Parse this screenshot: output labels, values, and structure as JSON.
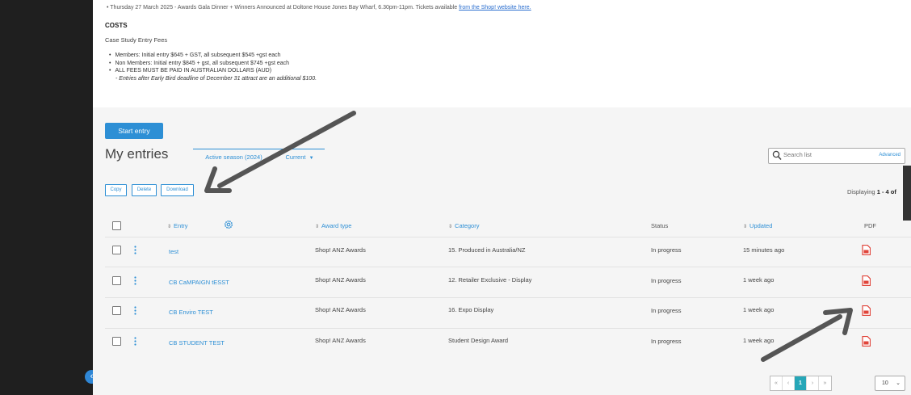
{
  "top": {
    "cut_line": "• Thursday 27 March 2025 - Awards Gala Dinner + Winners Announced at Doltone House Jones Bay Wharf, 6.30pm-11pm. Tickets available",
    "cut_link": "from the Shop! website here.",
    "costs_title": "COSTS",
    "costs_sub": "Case Study Entry Fees",
    "fees": [
      "Members: Initial entry $645 + GST, all subsequent $545 +gst each",
      "Non Members: Initial entry $845 + gst, all subsequent $745 +gst each",
      "ALL FEES MUST BE PAID IN AUSTRALIAN DOLLARS (AUD)"
    ],
    "fees_note": "- Entries after Early Bird deadline of December 31 attract are an additional $100."
  },
  "entries": {
    "start_label": "Start entry",
    "title": "My entries",
    "tab_active": "Active season (2024)",
    "tab_current": "Current",
    "search_placeholder": "Search list",
    "advanced_label": "Advanced",
    "copy_label": "Copy",
    "delete_label": "Delete",
    "download_label": "Download",
    "displaying_prefix": "Displaying",
    "displaying_range": "1 - 4 of",
    "columns": {
      "entry": "Entry",
      "award_type": "Award type",
      "category": "Category",
      "status": "Status",
      "updated": "Updated",
      "pdf": "PDF"
    },
    "rows": [
      {
        "entry": "test",
        "award_type": "Shop! ANZ Awards",
        "category": "15. Produced in Australia/NZ",
        "status": "In progress",
        "updated": "15 minutes ago"
      },
      {
        "entry": "CB CaMPAIGN tESST",
        "award_type": "Shop! ANZ Awards",
        "category": "12. Retailer Exclusive - Display",
        "status": "In progress",
        "updated": "1 week ago"
      },
      {
        "entry": "CB Enviro TEST",
        "award_type": "Shop! ANZ Awards",
        "category": "16. Expo Display",
        "status": "In progress",
        "updated": "1 week ago"
      },
      {
        "entry": "CB STUDENT TEST",
        "award_type": "Shop! ANZ Awards",
        "category": "Student Design Award",
        "status": "In progress",
        "updated": "1 week ago"
      }
    ],
    "pager": {
      "first": "«",
      "prev": "‹",
      "current_page": "1",
      "next": "›",
      "last": "»"
    },
    "page_size": "10"
  },
  "colors": {
    "accent": "#2d8fd5",
    "sidebar": "#1f1f1f",
    "pdf": "#e0443a",
    "annotation_arrow": "#555555"
  }
}
